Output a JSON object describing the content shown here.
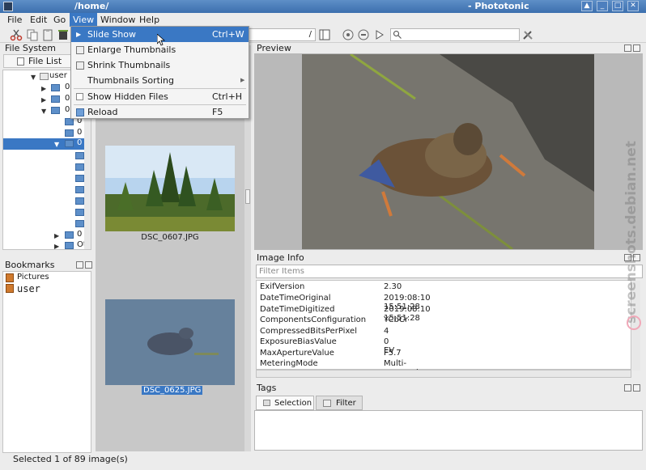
{
  "window": {
    "title_left": "/home/",
    "title_right": "- Phototonic"
  },
  "menubar": [
    "File",
    "Edit",
    "Go",
    "View",
    "Window",
    "Help"
  ],
  "view_menu": [
    {
      "label": "Slide Show",
      "shortcut": "Ctrl+W"
    },
    {
      "label": "Enlarge Thumbnails",
      "shortcut": ""
    },
    {
      "label": "Shrink Thumbnails",
      "shortcut": ""
    },
    {
      "label": "Thumbnails Sorting",
      "shortcut": ""
    },
    {
      "label": "Show Hidden Files",
      "shortcut": "Ctrl+H"
    },
    {
      "label": "Reload",
      "shortcut": "F5"
    }
  ],
  "toolbar": {
    "path_tail": "/"
  },
  "file_system": {
    "title": "File System",
    "tab_label": "File List",
    "tree": [
      {
        "label": "user"
      },
      {
        "label": "0"
      },
      {
        "label": "0"
      },
      {
        "label": "0"
      },
      {
        "label": "0"
      },
      {
        "label": "0"
      },
      {
        "label": "0"
      },
      {
        "label": "0"
      },
      {
        "label": "Ot"
      }
    ]
  },
  "bookmarks": {
    "title": "Bookmarks",
    "items": [
      "Pictures",
      "user"
    ]
  },
  "thumbnails": {
    "items": [
      "DSC_0607.JPG",
      "DSC_0625.JPG"
    ]
  },
  "preview": {
    "title": "Preview"
  },
  "image_info": {
    "title": "Image Info",
    "filter_placeholder": "Filter Items",
    "rows": [
      {
        "key": "ExifVersion",
        "value": "2.30"
      },
      {
        "key": "DateTimeOriginal",
        "value": "2019:08:10 15:51:28"
      },
      {
        "key": "DateTimeDigitized",
        "value": "2019:08:10 15:51:28"
      },
      {
        "key": "ComponentsConfiguration",
        "value": "YCbCr"
      },
      {
        "key": "CompressedBitsPerPixel",
        "value": "4"
      },
      {
        "key": "ExposureBiasValue",
        "value": "0 EV"
      },
      {
        "key": "MaxApertureValue",
        "value": "F5.7"
      },
      {
        "key": "MeteringMode",
        "value": "Multi-segment"
      }
    ]
  },
  "tags": {
    "title": "Tags",
    "tabs": [
      "Selection",
      "Filter"
    ]
  },
  "status": {
    "text": "Selected 1 of  89 image(s)"
  },
  "watermark": "screenshots.debian.net"
}
